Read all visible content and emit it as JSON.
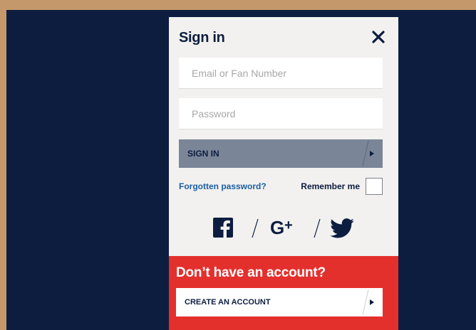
{
  "modal": {
    "title": "Sign in",
    "email_placeholder": "Email or Fan Number",
    "password_placeholder": "Password",
    "signin_label": "SIGN IN",
    "forgot_label": "Forgotten password?",
    "remember_label": "Remember me",
    "remember_checked": false
  },
  "social": {
    "icons": [
      "facebook-icon",
      "google-plus-icon",
      "twitter-icon"
    ],
    "separator": "/"
  },
  "cta": {
    "title": "Don’t have an account?",
    "create_label": "CREATE AN ACCOUNT"
  },
  "colors": {
    "page_border": "#c4986a",
    "backdrop": "#0d1d40",
    "modal_bg": "#f2f1ef",
    "navy": "#0d1d40",
    "signin_button": "#7a8598",
    "link": "#1b5ea3",
    "cta_red": "#e4302d"
  }
}
